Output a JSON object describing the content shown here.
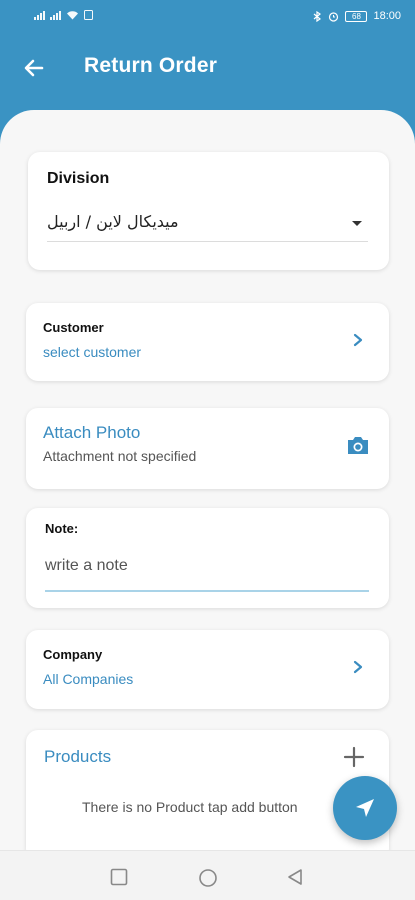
{
  "statusbar": {
    "left_text": "4G 4G",
    "battery": "68",
    "time": "18:00"
  },
  "appbar": {
    "title": "Return Order",
    "back_icon": "arrow-left-icon"
  },
  "division": {
    "label": "Division",
    "value": "میدیکال لاین / اربیل"
  },
  "customer": {
    "label": "Customer",
    "value": "select customer"
  },
  "attach": {
    "label": "Attach Photo",
    "status": "Attachment not specified",
    "icon": "camera-icon"
  },
  "note": {
    "label": "Note:",
    "placeholder": "write a note",
    "value": ""
  },
  "company": {
    "label": "Company",
    "value": "All Companies"
  },
  "products": {
    "label": "Products",
    "empty_text": "There is no Product tap add button",
    "add_icon": "plus-icon"
  },
  "fab": {
    "icon": "send-icon"
  },
  "navbar": {
    "icons": [
      "square-icon",
      "circle-icon",
      "triangle-back-icon"
    ]
  },
  "colors": {
    "primary": "#3a93c3",
    "accent_text": "#3a8cc0",
    "background": "#f7f7f7"
  }
}
